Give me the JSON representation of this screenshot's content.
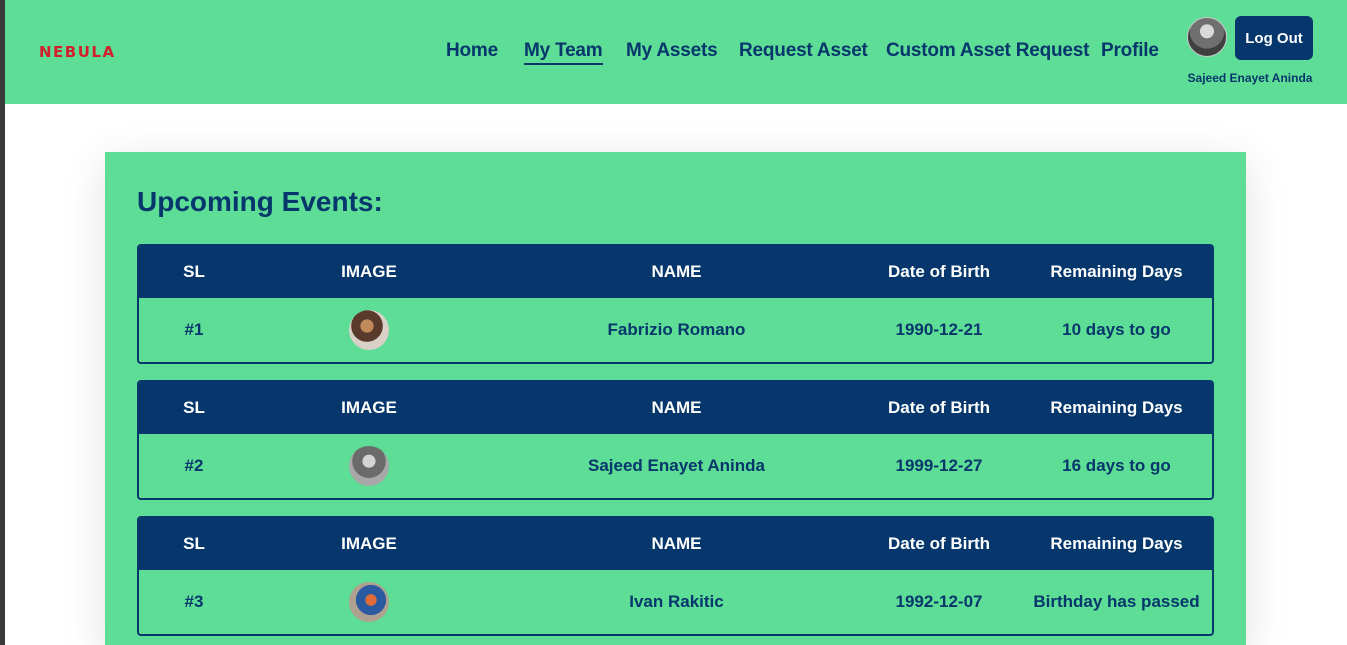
{
  "header": {
    "brand": "NEBULA",
    "nav": [
      {
        "label": "Home",
        "active": false
      },
      {
        "label": "My Team",
        "active": true
      },
      {
        "label": "My Assets",
        "active": false
      },
      {
        "label": "Request Asset",
        "active": false
      },
      {
        "label": "Custom Asset Request",
        "active": false
      },
      {
        "label": "Profile",
        "active": false
      }
    ],
    "logout_label": "Log Out",
    "user_name": "Sajeed Enayet Aninda"
  },
  "main": {
    "title": "Upcoming Events:",
    "columns": [
      "SL",
      "IMAGE",
      "NAME",
      "Date of Birth",
      "Remaining Days"
    ],
    "events": [
      {
        "sl": "#1",
        "name": "Fabrizio Romano",
        "dob": "1990-12-21",
        "remaining": "10 days to go"
      },
      {
        "sl": "#2",
        "name": "Sajeed Enayet Aninda",
        "dob": "1999-12-27",
        "remaining": "16 days to go"
      },
      {
        "sl": "#3",
        "name": "Ivan Rakitic",
        "dob": "1992-12-07",
        "remaining": "Birthday has passed"
      }
    ]
  },
  "colors": {
    "accent_green": "#5ddd95",
    "navy": "#05366c",
    "brand_red": "#d21f2b"
  }
}
